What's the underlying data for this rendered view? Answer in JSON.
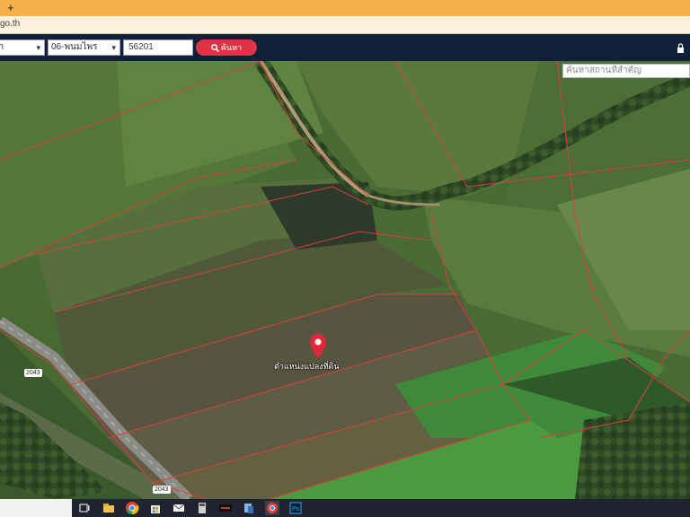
{
  "browser": {
    "new_tab_symbol": "+",
    "url_partial": "go.th"
  },
  "toolbar": {
    "province_select_partial": "ก",
    "district_select": "06-พนมไพร",
    "postal_code": "56201",
    "search_button_label": "ค้นหา"
  },
  "map": {
    "place_search_placeholder": "ค้นหาสถานที่สำคัญ",
    "marker_label": "ตำแหน่งแปลงที่ดิน",
    "road_labels": [
      "2043",
      "2043"
    ]
  },
  "taskbar": {
    "icons": [
      "taskview-icon",
      "file-explorer-icon",
      "chrome-icon",
      "store-icon",
      "mail-icon",
      "calculator-icon",
      "app-icon",
      "app-icon",
      "chrome-active-icon",
      "photoshop-icon"
    ]
  },
  "colors": {
    "browser_tab_bar": "#f6b24a",
    "url_bar": "#fbf1de",
    "navbar": "#10203a",
    "search_button": "#dc3545",
    "parcel_boundary": "#d84040",
    "marker": "#e0283a"
  }
}
